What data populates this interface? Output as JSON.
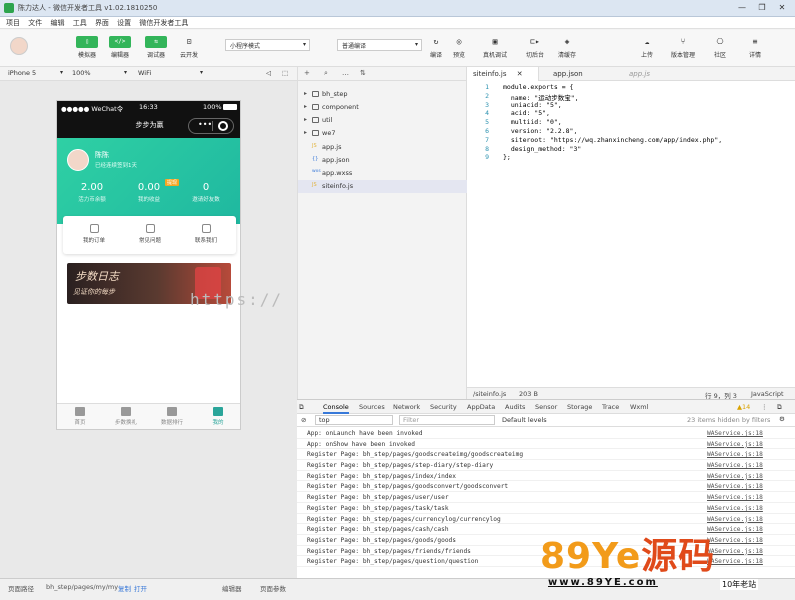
{
  "window": {
    "title": "陈力达人 - 微信开发者工具 v1.02.1810250",
    "controls": [
      "—",
      "❐",
      "✕"
    ]
  },
  "menu": [
    "项目",
    "文件",
    "编辑",
    "工具",
    "界面",
    "设置",
    "微信开发者工具"
  ],
  "toolbar": {
    "buttons": [
      {
        "icon": "▯",
        "label": "模拟器"
      },
      {
        "icon": "</>",
        "label": "编辑器"
      },
      {
        "icon": "⇆",
        "label": "调试器"
      },
      {
        "icon": "⊡",
        "label": "云开发"
      }
    ],
    "mode_select": "小程序模式",
    "compile_select": "普通编译",
    "right_buttons": [
      {
        "icon": "↻",
        "label": "编译"
      },
      {
        "icon": "◎",
        "label": "预览"
      },
      {
        "icon": "▣",
        "label": "真机调试"
      },
      {
        "icon": "⊏▸",
        "label": "切后台"
      },
      {
        "icon": "◈",
        "label": "清缓存"
      },
      {
        "icon": "☁",
        "label": "上传"
      },
      {
        "icon": "⑂",
        "label": "版本管理"
      },
      {
        "icon": "⎔",
        "label": "社区"
      },
      {
        "icon": "≡",
        "label": "详情"
      }
    ]
  },
  "device_bar": {
    "device": "iPhone 5",
    "zoom": "100%",
    "network": "WiFi"
  },
  "phone": {
    "carrier": "●●●●● WeChat令",
    "time": "16:33",
    "battery": "100%",
    "nav_title": "步步为赢",
    "user_name": "陈陈",
    "user_sub": "已经连续签到1天",
    "stats": [
      {
        "value": "2.00",
        "label": "活力币余额"
      },
      {
        "value": "0.00",
        "label": "我的收益",
        "badge": "提现"
      },
      {
        "value": "0",
        "label": "邀请好友数"
      }
    ],
    "menu": [
      "我的订单",
      "常见问题",
      "联系我们"
    ],
    "banner_title": "步数日志",
    "banner_sub": "见证你的每步",
    "tabs": [
      "首页",
      "步数换礼",
      "数据排行",
      "我的"
    ],
    "active_tab": 3
  },
  "watermark": "https://",
  "explorer": {
    "items": [
      {
        "type": "folder",
        "name": "bh_step"
      },
      {
        "type": "folder",
        "name": "component"
      },
      {
        "type": "folder",
        "name": "util"
      },
      {
        "type": "folder",
        "name": "we7"
      },
      {
        "type": "js",
        "name": "app.js"
      },
      {
        "type": "json",
        "name": "app.json"
      },
      {
        "type": "wxss",
        "name": "app.wxss"
      },
      {
        "type": "js",
        "name": "siteinfo.js"
      }
    ],
    "selected": 7
  },
  "editor": {
    "tabs": [
      "siteinfo.js",
      "app.json",
      "app.js"
    ],
    "lines": [
      {
        "n": "1",
        "code": "module.exports = {"
      },
      {
        "n": "2",
        "code": "  name: \"运动步数宝\","
      },
      {
        "n": "3",
        "code": "  uniacid: \"5\","
      },
      {
        "n": "4",
        "code": "  acid: \"5\","
      },
      {
        "n": "5",
        "code": "  multiid: \"0\","
      },
      {
        "n": "6",
        "code": "  version: \"2.2.8\","
      },
      {
        "n": "7",
        "code": "  siteroot: \"https://wq.zhanxincheng.com/app/index.php\","
      },
      {
        "n": "8",
        "code": "  design_method: \"3\""
      },
      {
        "n": "9",
        "code": "};"
      }
    ],
    "status_path": "/siteinfo.js",
    "status_size": "203 B",
    "status_pos": "行 9，列 3",
    "status_lang": "JavaScript"
  },
  "devtools": {
    "tabs": [
      "Console",
      "Sources",
      "Network",
      "Security",
      "AppData",
      "Audits",
      "Sensor",
      "Storage",
      "Trace",
      "Wxml"
    ],
    "warn_count": "▲14",
    "context": "top",
    "filter_placeholder": "Filter",
    "levels": "Default levels",
    "hidden_note": "23 items hidden by filters",
    "logs": [
      {
        "msg": "App: onLaunch have been invoked",
        "src": "WAService.js:18"
      },
      {
        "msg": "App: onShow have been invoked",
        "src": "WAService.js:18"
      },
      {
        "msg": "Register Page: bh_step/pages/goodscreateimg/goodscreateimg",
        "src": "WAService.js:18"
      },
      {
        "msg": "Register Page: bh_step/pages/step-diary/step-diary",
        "src": "WAService.js:18"
      },
      {
        "msg": "Register Page: bh_step/pages/index/index",
        "src": "WAService.js:18"
      },
      {
        "msg": "Register Page: bh_step/pages/goodsconvert/goodsconvert",
        "src": "WAService.js:18"
      },
      {
        "msg": "Register Page: bh_step/pages/user/user",
        "src": "WAService.js:18"
      },
      {
        "msg": "Register Page: bh_step/pages/task/task",
        "src": "WAService.js:18"
      },
      {
        "msg": "Register Page: bh_step/pages/currencylog/currencylog",
        "src": "WAService.js:18"
      },
      {
        "msg": "Register Page: bh_step/pages/cash/cash",
        "src": "WAService.js:18"
      },
      {
        "msg": "Register Page: bh_step/pages/goods/goods",
        "src": "WAService.js:18"
      },
      {
        "msg": "Register Page: bh_step/pages/friends/friends",
        "src": "WAService.js:18"
      },
      {
        "msg": "Register Page: bh_step/pages/question/question",
        "src": "WAService.js:18"
      }
    ]
  },
  "statusbar": {
    "label": "页面路径",
    "path": "bh_step/pages/my/my",
    "copy": "复制",
    "open": "打开",
    "right1": "编辑器",
    "right2": "页面参数"
  },
  "brand": {
    "big_a": "89Ye",
    "big_b": "源码",
    "url": "www.89YE.com",
    "tag": "10年老站"
  }
}
